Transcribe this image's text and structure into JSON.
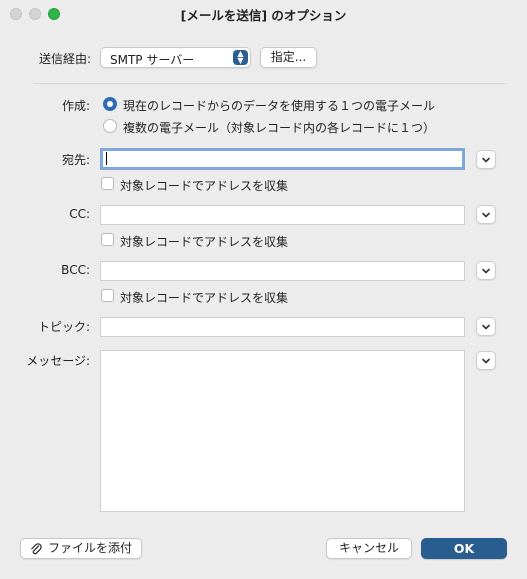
{
  "window": {
    "title": "[メールを送信] のオプション"
  },
  "send_via": {
    "label": "送信経由:",
    "selected": "SMTP サーバー",
    "specify_label": "指定..."
  },
  "create": {
    "label": "作成:",
    "options": [
      {
        "label": "現在のレコードからのデータを使用する１つの電子メール",
        "selected": true
      },
      {
        "label": "複数の電子メール（対象レコード内の各レコードに１つ）",
        "selected": false
      }
    ]
  },
  "to": {
    "label": "宛先:",
    "value": "",
    "checkbox_label": "対象レコードでアドレスを収集"
  },
  "cc": {
    "label": "CC:",
    "value": "",
    "checkbox_label": "対象レコードでアドレスを収集"
  },
  "bcc": {
    "label": "BCC:",
    "value": "",
    "checkbox_label": "対象レコードでアドレスを収集"
  },
  "topic": {
    "label": "トピック:",
    "value": ""
  },
  "message": {
    "label": "メッセージ:",
    "value": ""
  },
  "footer": {
    "attach_label": "ファイルを添付",
    "cancel_label": "キャンセル",
    "ok_label": "OK"
  },
  "icons": {
    "popup": "updown-arrows-icon",
    "expand": "chevron-down-icon",
    "attach": "paperclip-icon"
  },
  "colors": {
    "accent": "#2a5d8f",
    "radio_selected": "#2f6cb5",
    "focus_ring": "#7fa7d8",
    "zoom_button": "#2fb54a"
  }
}
